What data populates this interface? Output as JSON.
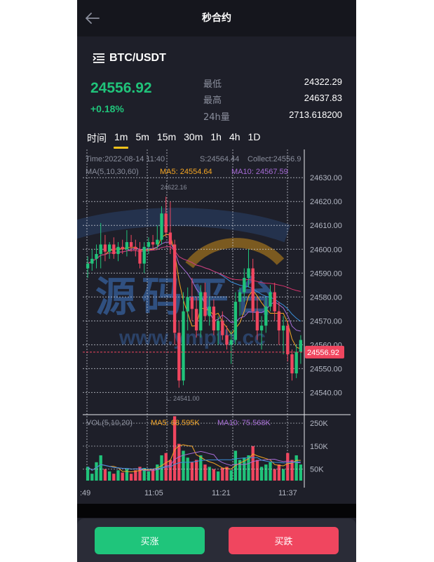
{
  "header": {
    "title": "秒合约"
  },
  "pair": {
    "name": "BTC/USDT"
  },
  "ticker": {
    "last_price": "24556.92",
    "change": "+0.18%",
    "stats": [
      {
        "label": "最低",
        "value": "24322.29"
      },
      {
        "label": "最高",
        "value": "24637.83"
      },
      {
        "label": "24h量",
        "value": "2713.618200"
      }
    ]
  },
  "timeframes": {
    "items": [
      "时间",
      "1m",
      "5m",
      "15m",
      "30m",
      "1h",
      "4h",
      "1D"
    ],
    "selected": "1m"
  },
  "kline": {
    "info_line": {
      "time": "Time:2022-08-14 11:40",
      "s": "S:24564.44",
      "collect": "Collect:24556.9"
    },
    "ma_line": {
      "label": "MA(5,10,30,60)",
      "ma5": "MA5: 24554.64",
      "ma10": "MA10: 24567.59"
    },
    "price_ticks": [
      "24630.00",
      "24620.00",
      "24610.00",
      "24600.00",
      "24590.00",
      "24580.00",
      "24570.00",
      "24560.00",
      "24550.00",
      "24540.00"
    ],
    "current_price_tag": "24556.92",
    "max_label": "24622.16",
    "min_label": "L: 24541.00",
    "vol_line": {
      "label": "VOL(5,10,20)",
      "ma5": "MA5: 68.595K",
      "ma10": "MA10: 75.568K"
    },
    "vol_ticks": [
      "250K",
      "150K",
      "50K"
    ],
    "time_ticks": [
      ":49",
      "11:05",
      "11:21",
      "11:37"
    ]
  },
  "watermark": {
    "text": "源码平台",
    "url_text": "www.ymptb.cc"
  },
  "actions": {
    "buy_up": "买涨",
    "buy_down": "买跌"
  },
  "colors": {
    "up": "#20c37a",
    "down": "#f0465f",
    "accent": "#f1c21b",
    "ma5": "#f5a623",
    "ma10": "#a66bd6",
    "ma30": "#3a8fd9",
    "ma60": "#d6336c"
  }
}
